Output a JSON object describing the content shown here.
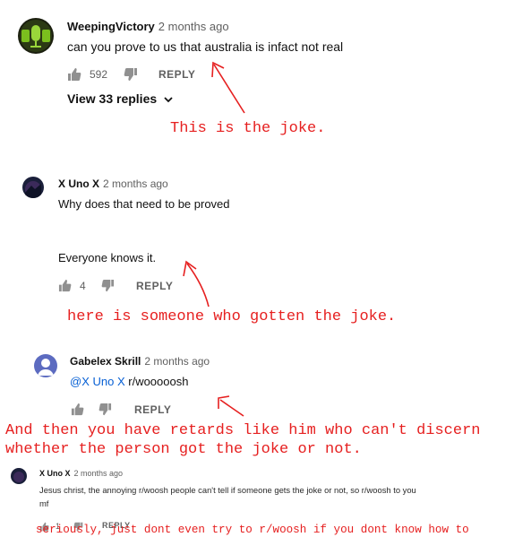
{
  "comments": {
    "c1": {
      "author": "WeepingVictory",
      "time": "2 months ago",
      "text": "can you prove to us that australia is infact not real",
      "likes": "592",
      "reply": "REPLY",
      "view_replies": "View 33 replies"
    },
    "c2": {
      "author": "X Uno X",
      "time": "2 months ago",
      "line1": "Why does that need to be proved",
      "line2": "Everyone knows it.",
      "likes": "4",
      "reply": "REPLY"
    },
    "c3": {
      "author": "Gabelex Skrill",
      "time": "2 months ago",
      "mention": "@X Uno X",
      "text": "r/wooooosh",
      "reply": "REPLY"
    },
    "c4": {
      "author": "X Uno X",
      "time": "2 months ago",
      "line1": "Jesus christ, the annoying r/woosh people can't tell if someone gets the joke or not, so r/woosh to you",
      "line2": "mf",
      "likes": "1",
      "reply": "REPLY"
    }
  },
  "annotations": {
    "a1": "This is the joke.",
    "a2": "here is someone who gotten the joke.",
    "a3_line1": "And then you have retards like him who can't discern",
    "a3_line2": "whether the person got the joke or not.",
    "a4": "seriously, just dont even try to r/woosh if you dont know how to"
  },
  "colors": {
    "annotation": "#e62020",
    "link": "#065fd4",
    "meta": "#606060"
  }
}
